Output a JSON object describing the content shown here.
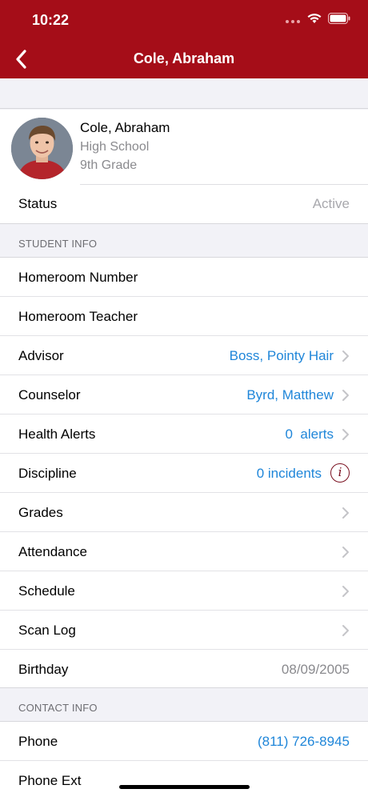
{
  "status_bar": {
    "time": "10:22"
  },
  "nav": {
    "title": "Cole, Abraham"
  },
  "profile": {
    "name": "Cole, Abraham",
    "school": "High School",
    "grade": "9th Grade",
    "status_label": "Status",
    "status_value": "Active"
  },
  "student_info": {
    "header": "STUDENT INFO",
    "rows": [
      {
        "label": "Homeroom Number",
        "value": ""
      },
      {
        "label": "Homeroom Teacher",
        "value": ""
      },
      {
        "label": "Advisor",
        "value": "Boss, Pointy Hair"
      },
      {
        "label": "Counselor",
        "value": "Byrd, Matthew"
      },
      {
        "label": "Health Alerts",
        "value": "0  alerts"
      },
      {
        "label": "Discipline",
        "value": "0 incidents"
      },
      {
        "label": "Grades",
        "value": ""
      },
      {
        "label": "Attendance",
        "value": ""
      },
      {
        "label": "Schedule",
        "value": ""
      },
      {
        "label": "Scan Log",
        "value": ""
      },
      {
        "label": "Birthday",
        "value": "08/09/2005"
      }
    ]
  },
  "contact_info": {
    "header": "CONTACT INFO",
    "rows": [
      {
        "label": "Phone",
        "value": "(811) 726-8945"
      },
      {
        "label": "Phone Ext",
        "value": ""
      }
    ]
  },
  "colors": {
    "header_bg": "#a50d18",
    "link": "#1f86d9",
    "info_icon": "#7a1020"
  }
}
